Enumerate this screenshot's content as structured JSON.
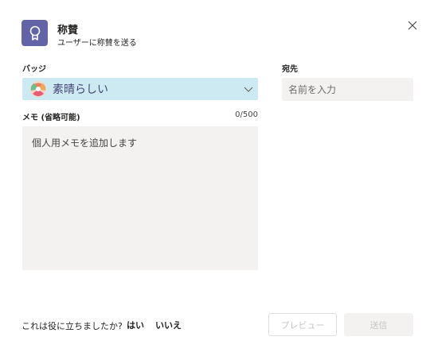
{
  "header": {
    "title": "称賛",
    "subtitle": "ユーザーに称賛を送る"
  },
  "badge": {
    "label": "バッジ",
    "selected": "素晴らしい"
  },
  "recipient": {
    "label": "宛先",
    "placeholder": "名前を入力"
  },
  "memo": {
    "label": "メモ (省略可能)",
    "counter": "0/500",
    "placeholder": "個人用メモを追加します"
  },
  "feedback": {
    "question": "これは役に立ちましたか?",
    "yes": "はい",
    "no": "いいえ"
  },
  "buttons": {
    "preview": "プレビュー",
    "send": "送信"
  },
  "colors": {
    "accent": "#6264a7",
    "badge_bg": "#cdeaf3",
    "field_bg": "#f3f2f1"
  }
}
